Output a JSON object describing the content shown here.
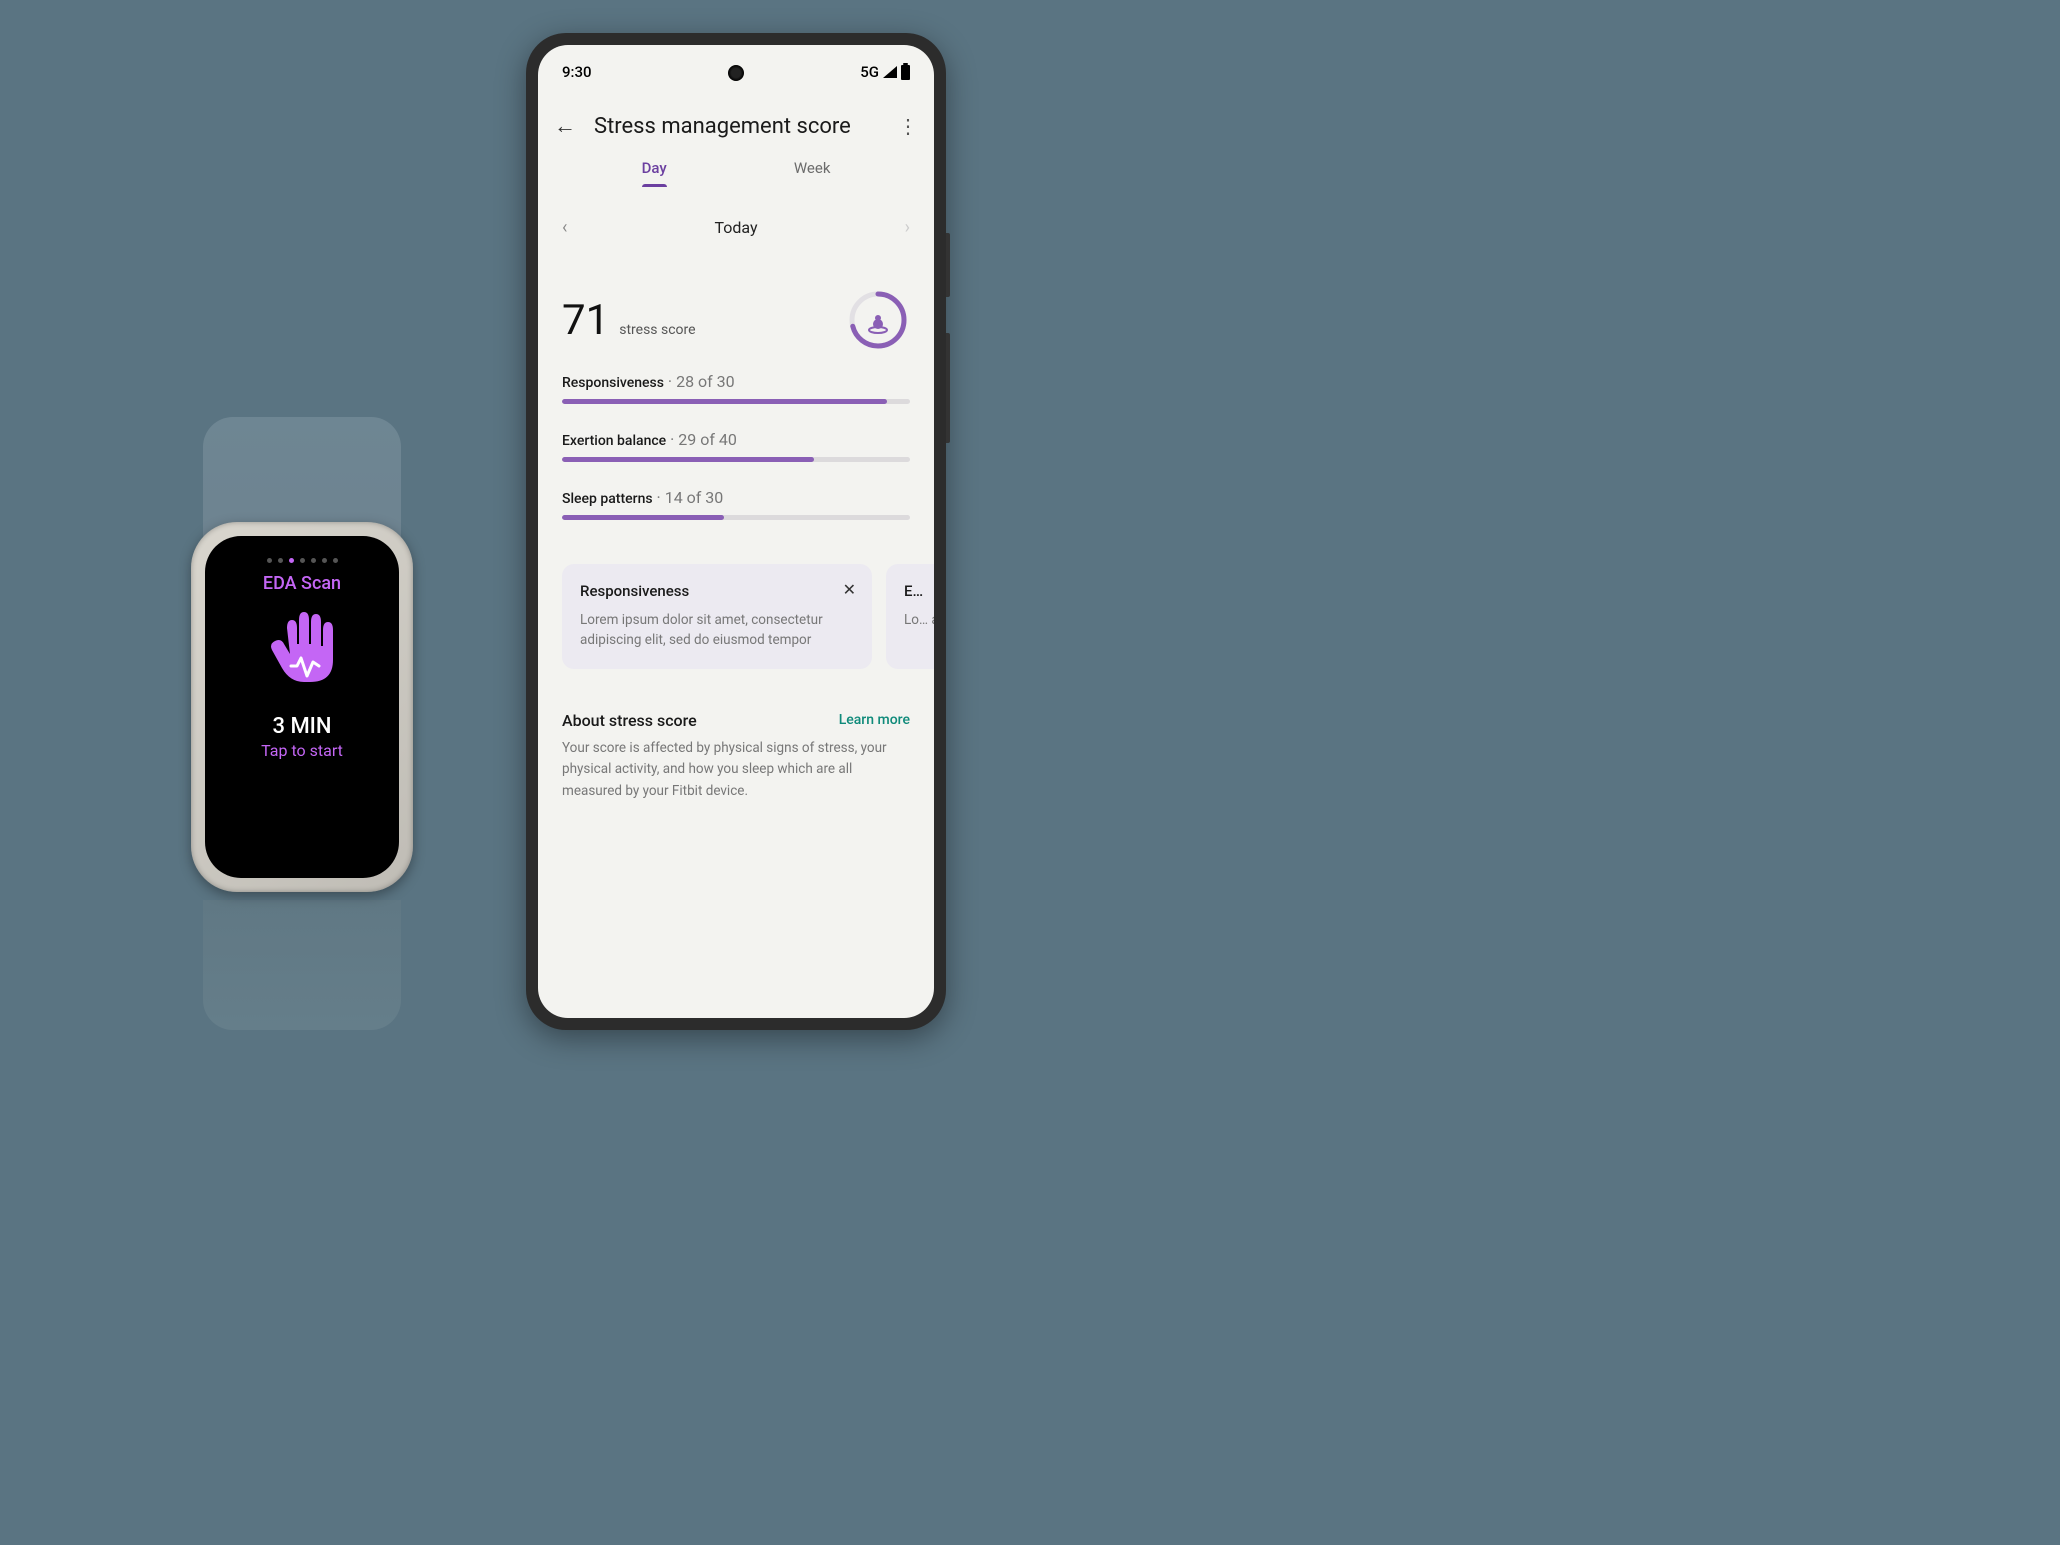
{
  "watch": {
    "dot_count": 7,
    "active_dot_index": 2,
    "title": "EDA Scan",
    "duration": "3 MIN",
    "tap_prompt": "Tap to start"
  },
  "status_bar": {
    "time": "9:30",
    "network": "5G"
  },
  "header": {
    "title": "Stress management score"
  },
  "tabs": {
    "day": "Day",
    "week": "Week",
    "active": "day"
  },
  "date_nav": {
    "label": "Today"
  },
  "score": {
    "value": "71",
    "label": "stress score",
    "ring_percent": 71
  },
  "metrics": [
    {
      "label": "Responsiveness",
      "value": 28,
      "max": 30
    },
    {
      "label": "Exertion balance",
      "value": 29,
      "max": 40
    },
    {
      "label": "Sleep patterns",
      "value": 14,
      "max": 30
    }
  ],
  "cards": [
    {
      "title": "Responsiveness",
      "body": "Lorem ipsum dolor sit amet, consectetur adipiscing elit, sed do eiusmod tempor"
    },
    {
      "title": "E…",
      "body": "Lo… ad…"
    }
  ],
  "about": {
    "title": "About stress score",
    "learn_more": "Learn more",
    "body": "Your score is affected by physical signs of stress, your physical activity, and how you sleep which are all measured by your Fitbit device."
  },
  "colors": {
    "accent": "#8a5fb5",
    "watch_accent": "#c466f5",
    "teal": "#0f8a7a"
  }
}
